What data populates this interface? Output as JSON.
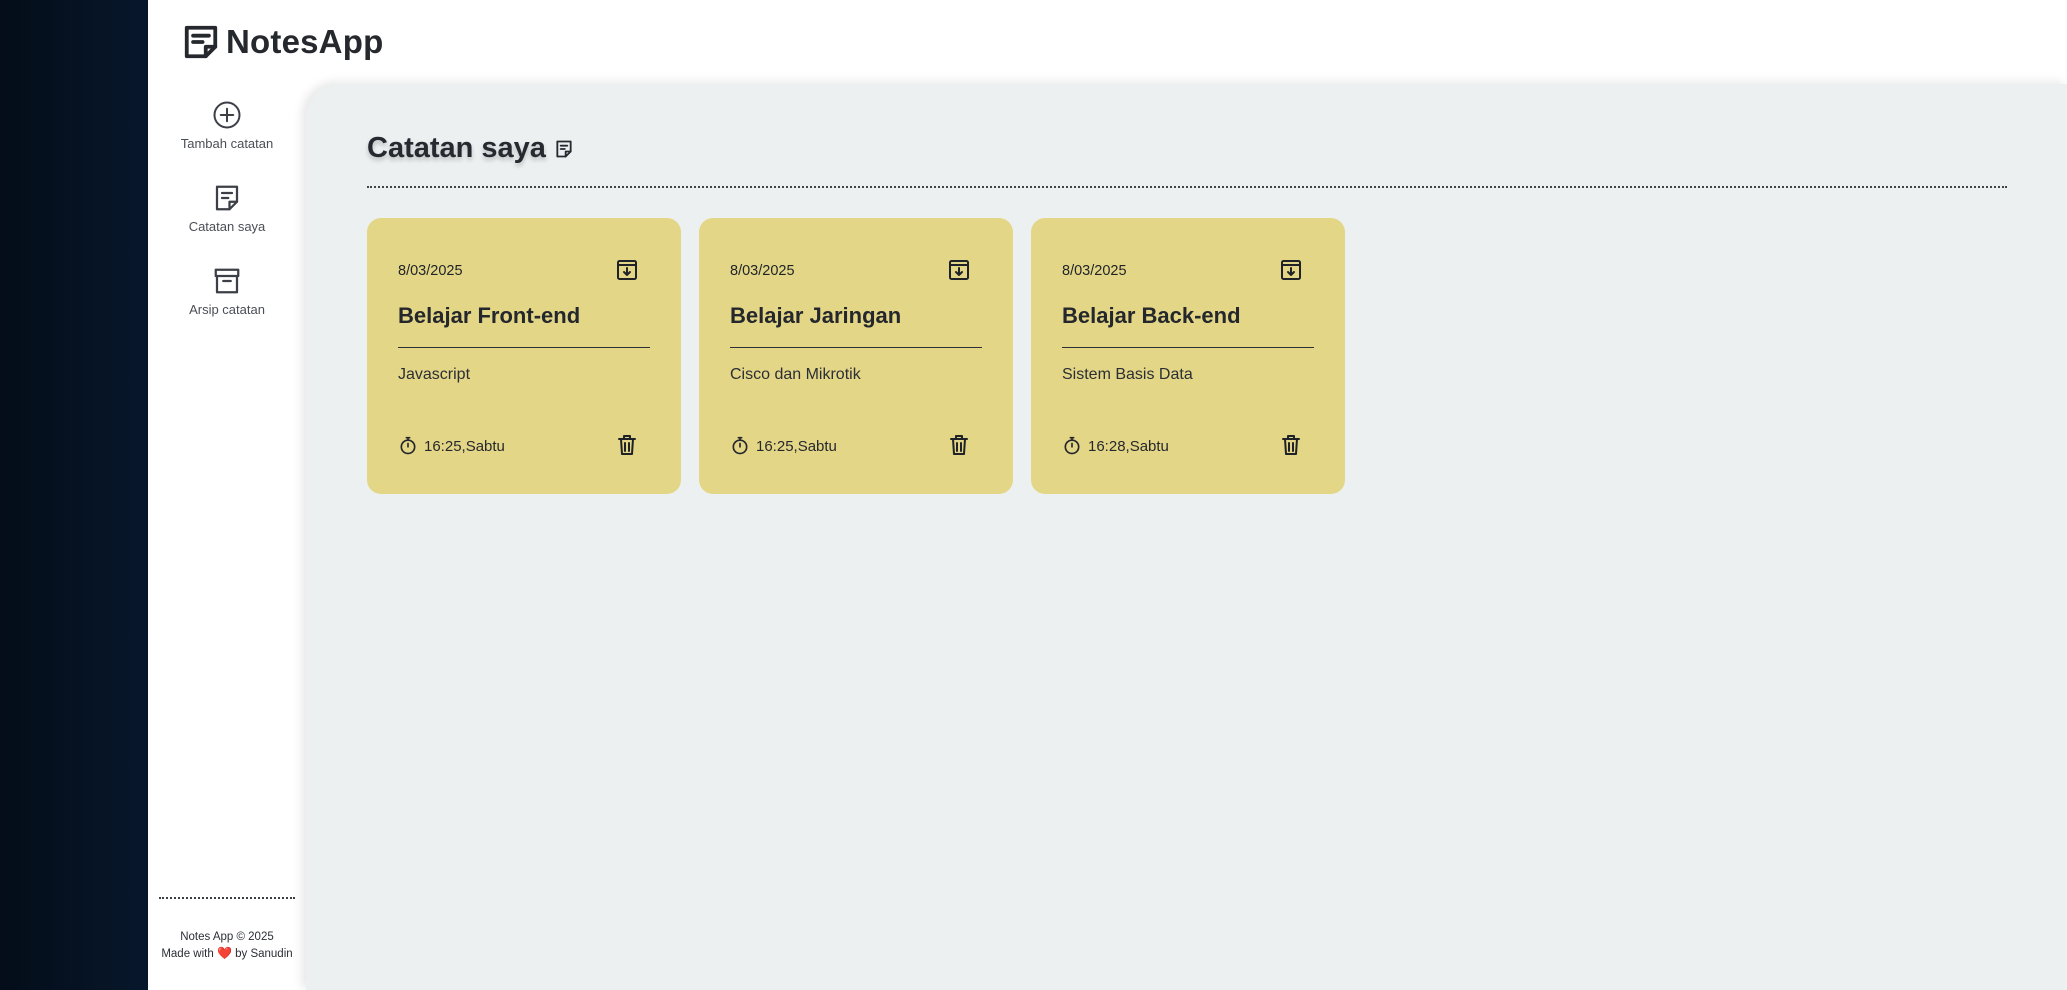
{
  "app": {
    "title": "NotesApp"
  },
  "sidebar": {
    "items": [
      {
        "label": "Tambah catatan",
        "icon": "add-circle-icon"
      },
      {
        "label": "Catatan saya",
        "icon": "note-icon"
      },
      {
        "label": "Arsip catatan",
        "icon": "archive-icon"
      }
    ],
    "footer": {
      "line1": "Notes App © 2025",
      "made_with": "Made with",
      "heart": "❤️",
      "by": "by Sanudin"
    }
  },
  "main": {
    "heading": "Catatan saya",
    "heading_icon": "note-icon"
  },
  "notes": [
    {
      "date": "8/03/2025",
      "title": "Belajar Front-end",
      "body": "Javascript",
      "time": "16:25,Sabtu"
    },
    {
      "date": "8/03/2025",
      "title": "Belajar Jaringan",
      "body": "Cisco dan Mikrotik",
      "time": "16:25,Sabtu"
    },
    {
      "date": "8/03/2025",
      "title": "Belajar Back-end",
      "body": "Sistem Basis Data",
      "time": "16:28,Sabtu"
    }
  ],
  "colors": {
    "backdrop": "#071224",
    "panel": "#edf0f1",
    "card": "#e4d687",
    "heart": "#e02424"
  }
}
